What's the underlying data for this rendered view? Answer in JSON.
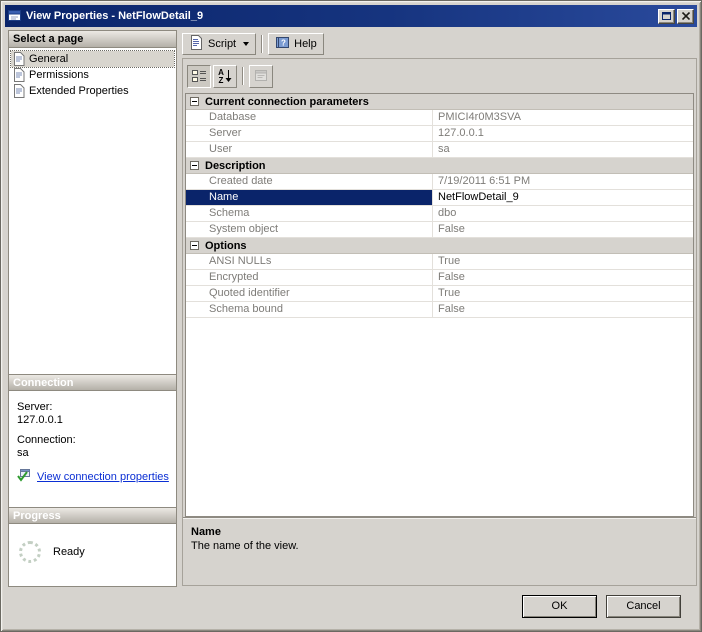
{
  "window": {
    "title": "View Properties - NetFlowDetail_9"
  },
  "sidebar": {
    "select_page_header": "Select a page",
    "pages": [
      {
        "label": "General"
      },
      {
        "label": "Permissions"
      },
      {
        "label": "Extended Properties"
      }
    ],
    "connection": {
      "header": "Connection",
      "server_label": "Server:",
      "server_value": "127.0.0.1",
      "connection_label": "Connection:",
      "connection_value": "sa",
      "link_label": "View connection properties"
    },
    "progress": {
      "header": "Progress",
      "status": "Ready"
    }
  },
  "toolbar": {
    "script_label": "Script",
    "help_label": "Help"
  },
  "icons": {
    "help_glyph": "?"
  },
  "grid_toolbar": {
    "sort_letters": {
      "top": "A",
      "bottom": "Z"
    }
  },
  "property_grid": {
    "categories": [
      {
        "name": "Current connection parameters",
        "rows": [
          {
            "label": "Database",
            "value": "PMICI4r0M3SVA"
          },
          {
            "label": "Server",
            "value": "127.0.0.1"
          },
          {
            "label": "User",
            "value": "sa"
          }
        ]
      },
      {
        "name": "Description",
        "rows": [
          {
            "label": "Created date",
            "value": "7/19/2011 6:51 PM"
          },
          {
            "label": "Name",
            "value": "NetFlowDetail_9"
          },
          {
            "label": "Schema",
            "value": "dbo"
          },
          {
            "label": "System object",
            "value": "False"
          }
        ]
      },
      {
        "name": "Options",
        "rows": [
          {
            "label": "ANSI NULLs",
            "value": "True"
          },
          {
            "label": "Encrypted",
            "value": "False"
          },
          {
            "label": "Quoted identifier",
            "value": "True"
          },
          {
            "label": "Schema bound",
            "value": "False"
          }
        ]
      }
    ],
    "help_panel": {
      "title": "Name",
      "description": "The name of the view."
    }
  },
  "footer": {
    "ok_label": "OK",
    "cancel_label": "Cancel"
  },
  "colors": {
    "titlebar": "#0a246a",
    "selection": "#0a246a",
    "link": "#0b2fd4",
    "window_bg": "#d6d3ce"
  }
}
